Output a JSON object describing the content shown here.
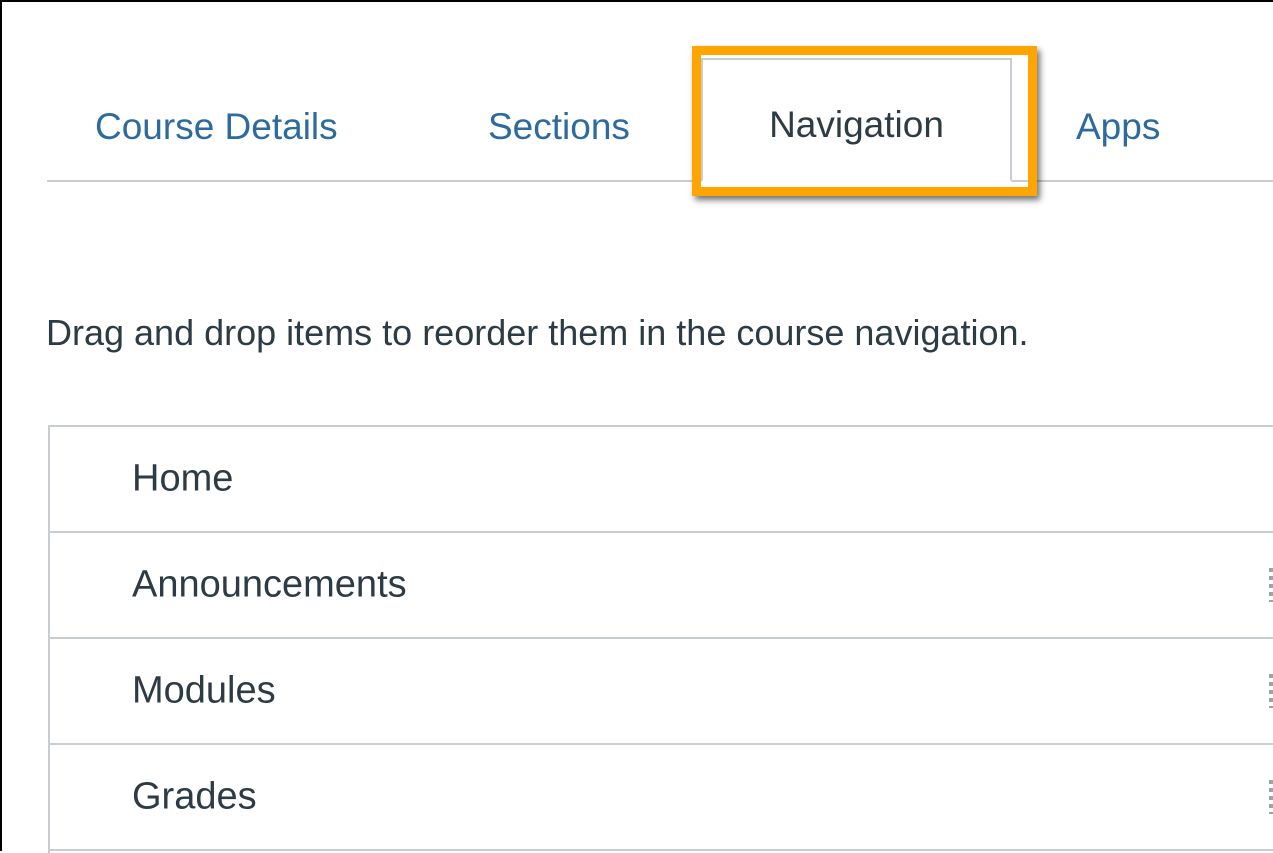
{
  "tabs": {
    "course_details": "Course Details",
    "sections": "Sections",
    "navigation": "Navigation",
    "apps": "Apps"
  },
  "instructions": "Drag and drop items to reorder them in the course navigation.",
  "nav_items": [
    {
      "label": "Home"
    },
    {
      "label": "Announcements"
    },
    {
      "label": "Modules"
    },
    {
      "label": "Grades"
    }
  ],
  "colors": {
    "tab_link": "#2d6a9f",
    "text": "#2d3b45",
    "border": "#c7cdd1",
    "highlight": "#ffa500"
  }
}
